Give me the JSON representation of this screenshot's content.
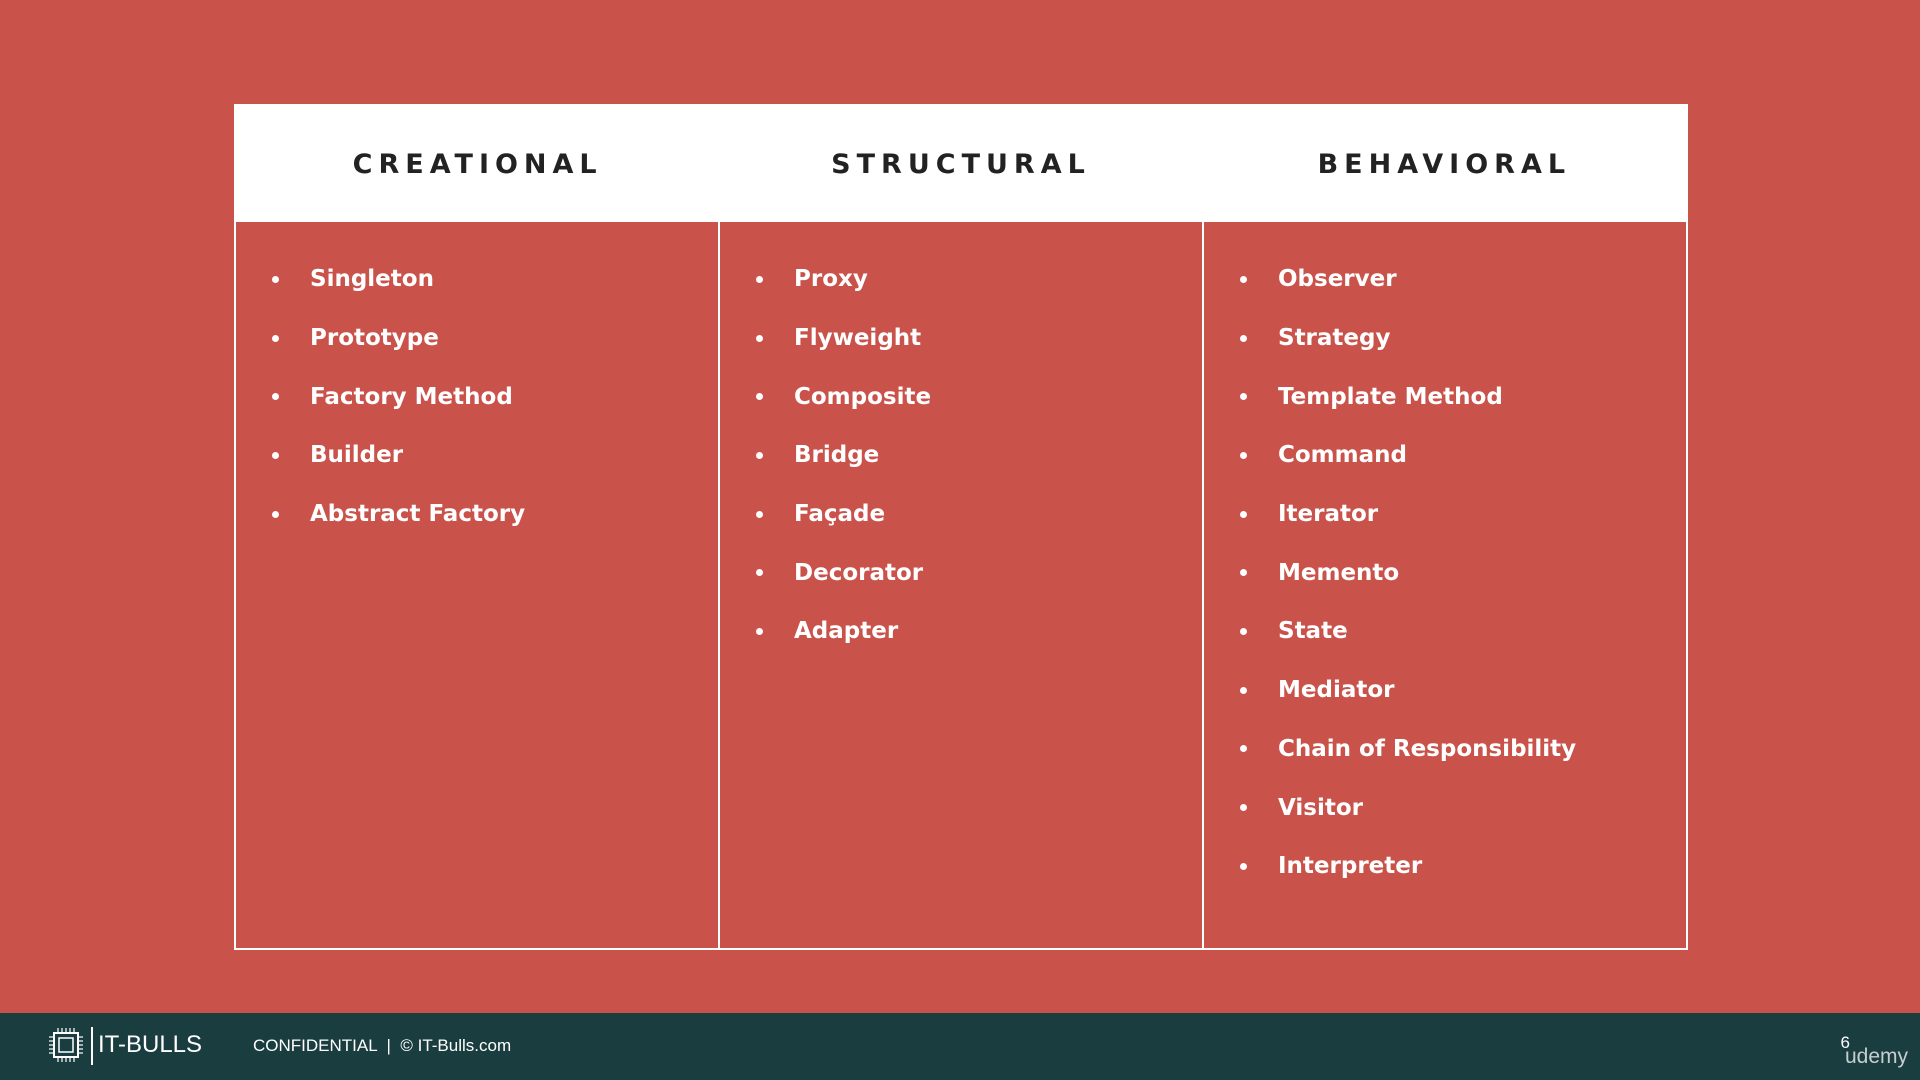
{
  "table": {
    "columns": [
      {
        "header": "CREATIONAL",
        "items": [
          "Singleton",
          "Prototype",
          "Factory Method",
          "Builder",
          "Abstract Factory"
        ]
      },
      {
        "header": "STRUCTURAL",
        "items": [
          "Proxy",
          "Flyweight",
          "Composite",
          "Bridge",
          "Façade",
          "Decorator",
          "Adapter"
        ]
      },
      {
        "header": "BEHAVIORAL",
        "items": [
          "Observer",
          "Strategy",
          "Template Method",
          "Command",
          "Iterator",
          "Memento",
          "State",
          "Mediator",
          "Chain of Responsibility",
          "Visitor",
          "Interpreter"
        ]
      }
    ]
  },
  "footer": {
    "logo_text": "IT-BULLS",
    "logo_icon": "chip-icon",
    "info_text": "CONFIDENTIAL  |  © IT-Bulls.com",
    "page_number": "6",
    "watermark": "udemy"
  },
  "colors": {
    "background": "#c9524a",
    "header_bg": "#ffffff",
    "footer_bg": "#1a3d40"
  }
}
